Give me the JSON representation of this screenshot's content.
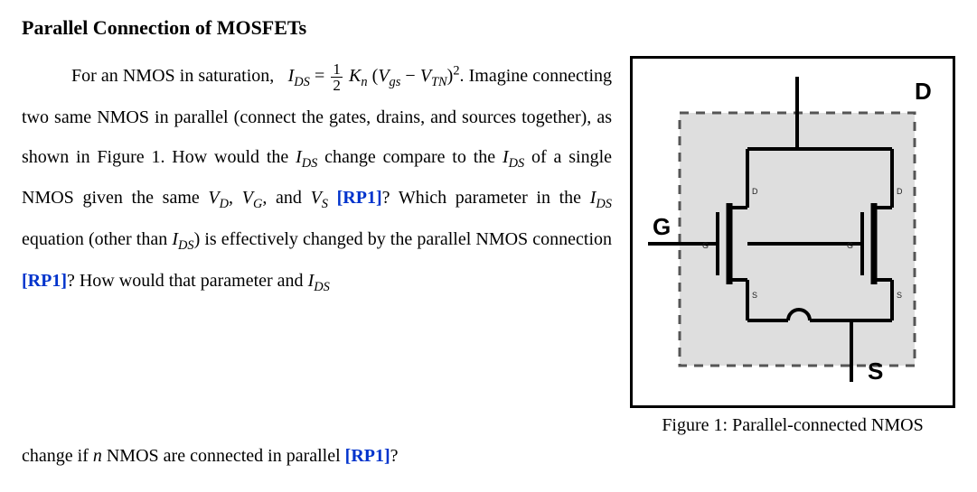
{
  "title": "Parallel Connection of MOSFETs",
  "para": {
    "lead": "For an NMOS in saturation,",
    "eq_lhs": "I",
    "eq_lhs_sub": "DS",
    "eq_eq": " = ",
    "eq_frac_num": "1",
    "eq_frac_den": "2",
    "eq_K": "K",
    "eq_K_sub": "n",
    "eq_open": "(",
    "eq_V1": "V",
    "eq_V1_sub": "gs",
    "eq_minus": " − ",
    "eq_V2": "V",
    "eq_V2_sub": "TN",
    "eq_close": ")",
    "eq_sq": "2",
    "eq_dot": ".",
    "s1a": "Imagine connecting two same NMOS in parallel (connect the gates, drains, and sources together), as shown in Figure 1. How would the ",
    "Ids": "I",
    "Ids_sub": "DS",
    "s1b": " change compare to the ",
    "s1c": " of a single NMOS given the same ",
    "VD": "V",
    "VD_sub": "D",
    "comma1": ", ",
    "VG": "V",
    "VG_sub": "G",
    "comma2": ", and ",
    "VS": "V",
    "VS_sub": "S",
    "rp1": " [RP1]",
    "s2a": "? Which parameter in the ",
    "s2b": " equation (other than ",
    "s2c": ") is effectively changed by the parallel NMOS connection ",
    "s3a": "? How would that parameter and ",
    "s3b": " change if ",
    "nvar": "n",
    "s3c": " NMOS are connected in parallel ",
    "s3q": "?"
  },
  "figure": {
    "terminals": {
      "D": "D",
      "G": "G",
      "S": "S"
    },
    "small_labels": {
      "D": "D",
      "G": "G",
      "S": "S"
    },
    "caption": "Figure 1: Parallel-connected NMOS"
  }
}
